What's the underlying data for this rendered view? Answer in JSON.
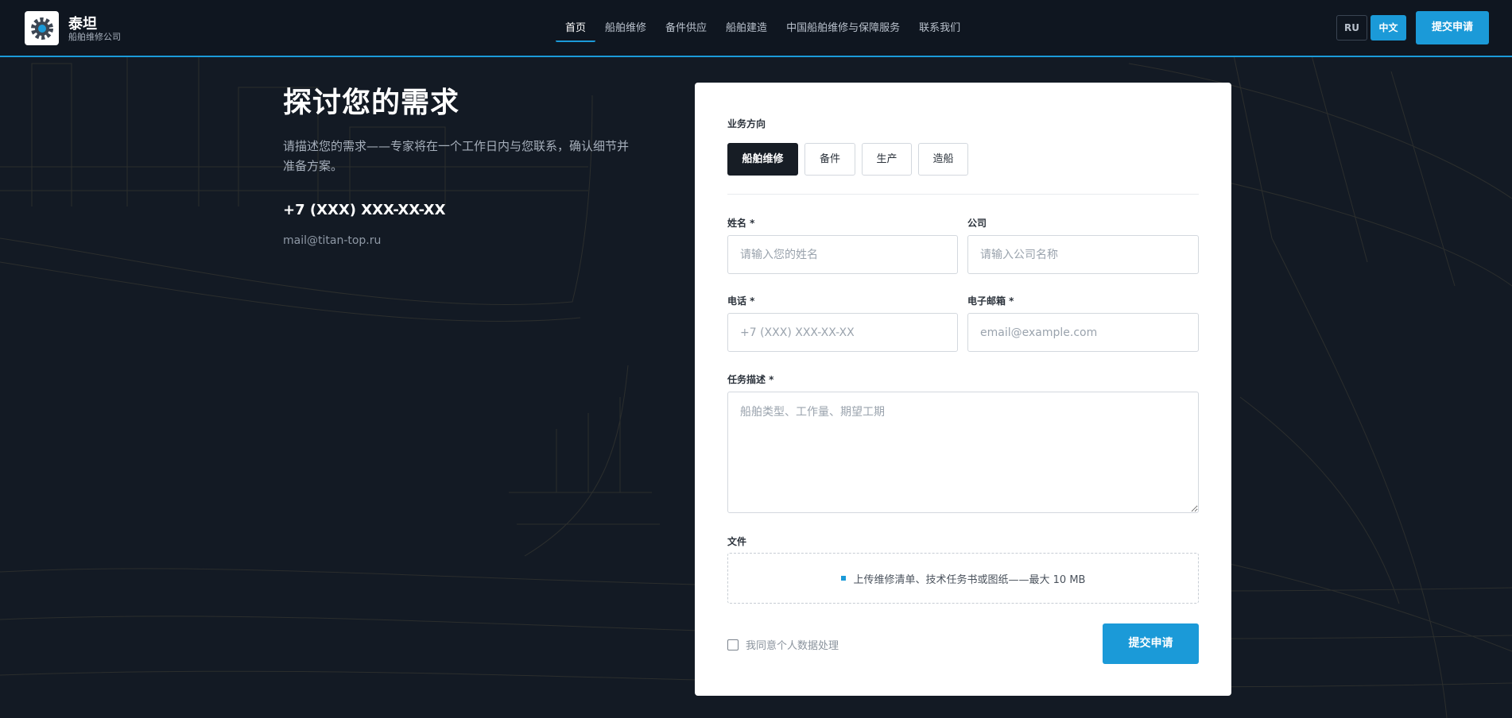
{
  "brand": {
    "name": "泰坦",
    "subtitle": "船舶维修公司"
  },
  "nav": [
    {
      "label": "首页",
      "active": true
    },
    {
      "label": "船舶维修"
    },
    {
      "label": "备件供应"
    },
    {
      "label": "船舶建造"
    },
    {
      "label": "中国船舶维修与保障服务"
    },
    {
      "label": "联系我们"
    }
  ],
  "header": {
    "lang_ru": "RU",
    "lang_zh": "中文",
    "cta": "提交申请"
  },
  "hero": {
    "title": "探讨您的需求",
    "description": "请描述您的需求——专家将在一个工作日内与您联系，确认细节并准备方案。",
    "phone": "+7 (XXX) XXX-XX-XX",
    "email": "mail@titan-top.ru"
  },
  "form": {
    "direction_label": "业务方向",
    "directions": [
      "船舶维修",
      "备件",
      "生产",
      "造船"
    ],
    "name_label": "姓名 *",
    "name_placeholder": "请输入您的姓名",
    "company_label": "公司",
    "company_placeholder": "请输入公司名称",
    "phone_label": "电话 *",
    "phone_placeholder": "+7 (XXX) XXX-XX-XX",
    "email_label": "电子邮箱 *",
    "email_placeholder": "email@example.com",
    "task_label": "任务描述 *",
    "task_placeholder": "船舶类型、工作量、期望工期",
    "files_label": "文件",
    "files_hint": "上传维修清单、技术任务书或图纸——最大 10 MB",
    "consent": "我同意个人数据处理",
    "submit": "提交申请"
  },
  "colors": {
    "accent": "#1b9ad8",
    "background": "#131a24",
    "header": "#0f1620",
    "card": "#ffffff"
  }
}
